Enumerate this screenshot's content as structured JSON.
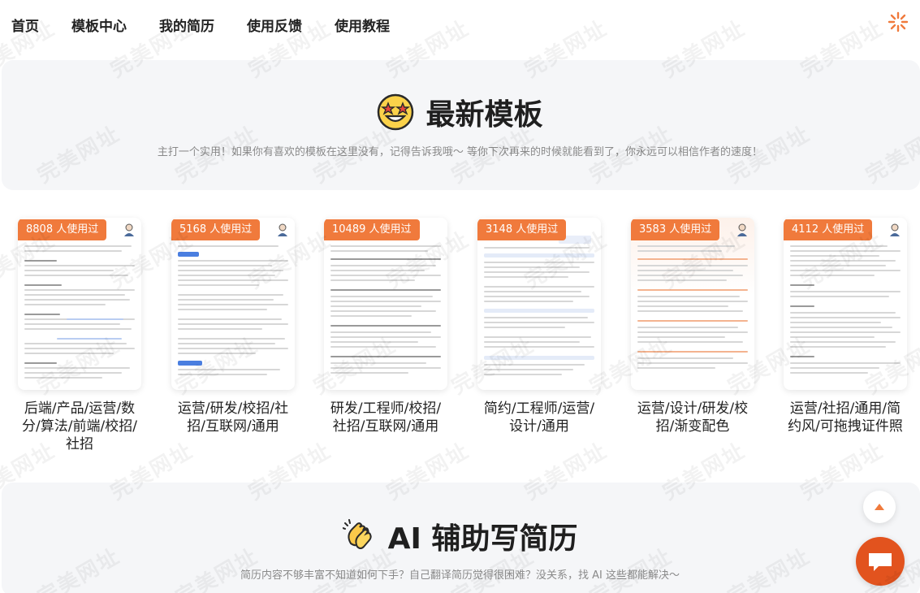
{
  "nav": {
    "items": [
      "首页",
      "模板中心",
      "我的简历",
      "使用反馈",
      "使用教程"
    ]
  },
  "latest": {
    "title": "最新模板",
    "subtitle": "主打一个实用！如果你有喜欢的模板在这里没有，记得告诉我哦～ 等你下次再来的时候就能看到了，你永远可以相信作者的速度！",
    "cards": [
      {
        "badge": "8808 人使用过",
        "label": "后端/产品/运营/数分/算法/前端/校招/社招"
      },
      {
        "badge": "5168 人使用过",
        "label": "运营/研发/校招/社招/互联网/通用"
      },
      {
        "badge": "10489 人使用过",
        "label": "研发/工程师/校招/社招/互联网/通用"
      },
      {
        "badge": "3148 人使用过",
        "label": "简约/工程师/运营/设计/通用"
      },
      {
        "badge": "3583 人使用过",
        "label": "运营/设计/研发/校招/渐变配色"
      },
      {
        "badge": "4112 人使用过",
        "label": "运营/社招/通用/简约风/可拖拽证件照"
      }
    ]
  },
  "ai": {
    "title": "AI 辅助写简历",
    "subtitle": "简历内容不够丰富不知道如何下手？自己翻译简历觉得很困难？没关系，找 AI 这些都能解决～"
  },
  "watermark": "完美网址",
  "colors": {
    "accent": "#f07a3c",
    "chat": "#e2531e",
    "panel": "#f5f6f8"
  },
  "icons": {
    "logo": "sun-logo-icon",
    "latest": "star-struck-emoji-icon",
    "ai": "clapping-hands-emoji-icon",
    "scroll_top": "arrow-up-icon",
    "chat": "chat-bubble-icon"
  }
}
